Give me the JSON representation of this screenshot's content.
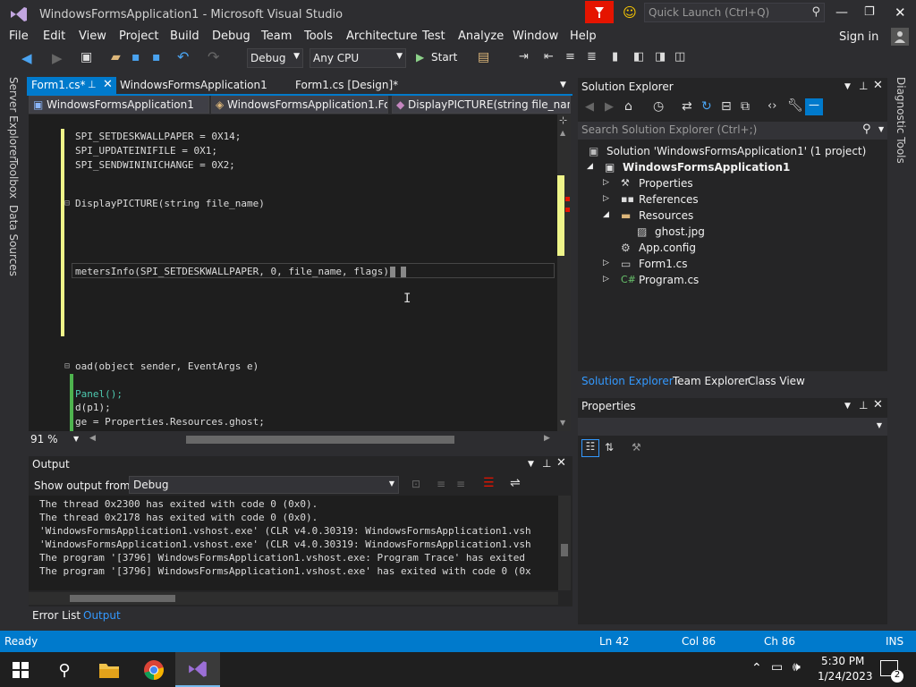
{
  "window": {
    "title": "WindowsFormsApplication1 - Microsoft Visual Studio",
    "quick_launch_placeholder": "Quick Launch (Ctrl+Q)",
    "sign_in": "Sign in"
  },
  "menu": [
    "File",
    "Edit",
    "View",
    "Project",
    "Build",
    "Debug",
    "Team",
    "Tools",
    "Architecture",
    "Test",
    "Analyze",
    "Window",
    "Help"
  ],
  "toolbar": {
    "config": "Debug",
    "platform": "Any CPU",
    "start_label": "Start"
  },
  "left_side_tabs": [
    "Server Explorer",
    "Toolbox",
    "Data Sources"
  ],
  "right_side_tabs": [
    "Diagnostic Tools"
  ],
  "doc_tabs": [
    {
      "label": "Form1.cs*",
      "active": true
    },
    {
      "label": "WindowsFormsApplication1",
      "active": false
    },
    {
      "label": "Form1.cs [Design]*",
      "active": false
    }
  ],
  "nav": {
    "project": "WindowsFormsApplication1",
    "class": "WindowsFormsApplication1.Fo",
    "member": "DisplayPICTURE(string file_nam"
  },
  "code": [
    {
      "text": "SPI_SETDESKWALLPAPER = 0X14;"
    },
    {
      "text": "SPI_UPDATEINIFILE = 0X1;"
    },
    {
      "text": "SPI_SENDWININICHANGE = 0X2;"
    },
    {
      "text": "DisplayPICTURE(string file_name)"
    },
    {
      "text": "metersInfo(SPI_SETDESKWALLPAPER, 0, file_name, flags))"
    },
    {
      "text": "oad(object sender, EventArgs e)"
    },
    {
      "text": "Panel();"
    },
    {
      "text": "d(p1);"
    },
    {
      "text": "ge = Properties.Resources.ghost;"
    }
  ],
  "zoom": "91 %",
  "output": {
    "title": "Output",
    "show_from_label": "Show output from:",
    "source": "Debug",
    "lines": [
      "The thread 0x2300 has exited with code 0 (0x0).",
      "The thread 0x2178 has exited with code 0 (0x0).",
      "'WindowsFormsApplication1.vshost.exe' (CLR v4.0.30319: WindowsFormsApplication1.vsh",
      "'WindowsFormsApplication1.vshost.exe' (CLR v4.0.30319: WindowsFormsApplication1.vsh",
      "The program '[3796] WindowsFormsApplication1.vshost.exe: Program Trace' has exited",
      "The program '[3796] WindowsFormsApplication1.vshost.exe' has exited with code 0 (0x"
    ],
    "bottom_tabs": [
      "Error List",
      "Output"
    ]
  },
  "solution_explorer": {
    "title": "Solution Explorer",
    "search_placeholder": "Search Solution Explorer (Ctrl+;)",
    "solution": "Solution 'WindowsFormsApplication1' (1 project)",
    "project": "WindowsFormsApplication1",
    "items": [
      "Properties",
      "References",
      "Resources",
      "ghost.jpg",
      "App.config",
      "Form1.cs",
      "Program.cs"
    ],
    "tabs": [
      "Solution Explorer",
      "Team Explorer",
      "Class View"
    ]
  },
  "properties": {
    "title": "Properties"
  },
  "status": {
    "ready": "Ready",
    "ln": "Ln 42",
    "col": "Col 86",
    "ch": "Ch 86",
    "mode": "INS"
  },
  "taskbar": {
    "time": "5:30 PM",
    "date": "1/24/2023",
    "notifications": "2"
  },
  "colors": {
    "accent": "#007acc",
    "vs_purple": "#68217a"
  }
}
